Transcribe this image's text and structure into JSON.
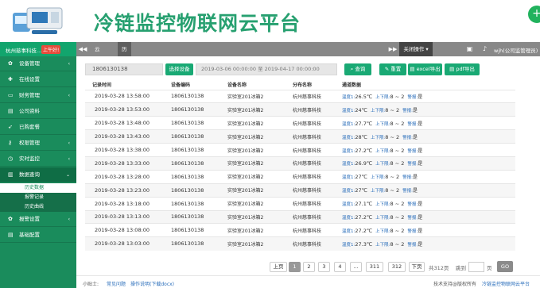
{
  "header": {
    "title": "冷链监控物联网云平台"
  },
  "topbar": {
    "user_name": "杭州慈事科技...",
    "shift": "上午好!",
    "nav_back": "◀◀",
    "nav_forward": "▶▶",
    "tabs": [
      "云中心",
      "历史数据"
    ],
    "close_ops": "关闭操作 ▾",
    "org": "wjh(公司监管理员)"
  },
  "sidebar": {
    "items": [
      {
        "label": "设备管理",
        "icon": "gear-icon",
        "arrow": "‹"
      },
      {
        "label": "在线设置",
        "icon": "signal-icon",
        "arrow": ""
      },
      {
        "label": "财务管理",
        "icon": "wallet-icon",
        "arrow": "‹"
      },
      {
        "label": "公司资料",
        "icon": "doc-icon",
        "arrow": ""
      },
      {
        "label": "已购套餐",
        "icon": "rocket-icon",
        "arrow": ""
      },
      {
        "label": "权限管理",
        "icon": "key-icon",
        "arrow": "‹"
      },
      {
        "label": "实时监控",
        "icon": "clock-icon",
        "arrow": "‹"
      },
      {
        "label": "数据查询",
        "icon": "chart-icon",
        "arrow": "⌄"
      }
    ],
    "sub_items": [
      "历史数据",
      "报警记录",
      "历史曲线"
    ],
    "after": [
      {
        "label": "报警设置",
        "icon": "bell-icon",
        "arrow": "‹"
      },
      {
        "label": "基础配置",
        "icon": "cog-icon",
        "arrow": ""
      }
    ]
  },
  "filters": {
    "device_code": "1806130138",
    "select_device": "选择设备",
    "date_range": "2019-03-06 00:00:00 至 2019-04-17 00:00:00",
    "query": "查询",
    "reset": "重置",
    "excel_export": "excel导出",
    "pdf_export": "pdf导出"
  },
  "table": {
    "columns": [
      "记录时间",
      "设备编码",
      "设备名称",
      "分布名称",
      "通道数据"
    ],
    "temp_label": "温度1:",
    "upper_label": "上下限:",
    "range": "8 ~ 2",
    "alarm_label": "警报:",
    "alarm_value": "是",
    "rows": [
      {
        "time": "2019-03-28 13:58:00",
        "code": "1806130138",
        "name": "实验室201冰箱2",
        "branch": "杭州慈事科技",
        "temp": "26.5℃"
      },
      {
        "time": "2019-03-28 13:53:00",
        "code": "1806130138",
        "name": "实验室201冰箱2",
        "branch": "杭州慈事科技",
        "temp": "24℃"
      },
      {
        "time": "2019-03-28 13:48:00",
        "code": "1806130138",
        "name": "实验室201冰箱2",
        "branch": "杭州慈事科技",
        "temp": "27.7℃"
      },
      {
        "time": "2019-03-28 13:43:00",
        "code": "1806130138",
        "name": "实验室201冰箱2",
        "branch": "杭州慈事科技",
        "temp": "28℃"
      },
      {
        "time": "2019-03-28 13:38:00",
        "code": "1806130138",
        "name": "实验室201冰箱2",
        "branch": "杭州慈事科技",
        "temp": "27.2℃"
      },
      {
        "time": "2019-03-28 13:33:00",
        "code": "1806130138",
        "name": "实验室201冰箱2",
        "branch": "杭州慈事科技",
        "temp": "26.9℃"
      },
      {
        "time": "2019-03-28 13:28:00",
        "code": "1806130138",
        "name": "实验室201冰箱2",
        "branch": "杭州慈事科技",
        "temp": "27℃"
      },
      {
        "time": "2019-03-28 13:23:00",
        "code": "1806130138",
        "name": "实验室201冰箱2",
        "branch": "杭州慈事科技",
        "temp": "27℃"
      },
      {
        "time": "2019-03-28 13:18:00",
        "code": "1806130138",
        "name": "实验室201冰箱2",
        "branch": "杭州慈事科技",
        "temp": "27.1℃"
      },
      {
        "time": "2019-03-28 13:13:00",
        "code": "1806130138",
        "name": "实验室201冰箱2",
        "branch": "杭州慈事科技",
        "temp": "27.2℃"
      },
      {
        "time": "2019-03-28 13:08:00",
        "code": "1806130138",
        "name": "实验室201冰箱2",
        "branch": "杭州慈事科技",
        "temp": "27.2℃"
      },
      {
        "time": "2019-03-28 13:03:00",
        "code": "1806130138",
        "name": "实验室201冰箱2",
        "branch": "杭州慈事科技",
        "temp": "27.3℃"
      }
    ]
  },
  "pagination": {
    "prev": "上页",
    "pages": [
      "1",
      "2",
      "3",
      "4",
      "...",
      "311",
      "312"
    ],
    "current": "1",
    "next": "下页",
    "total": "共312页",
    "goto_label": "跳到",
    "page_unit": "页",
    "go": "GO"
  },
  "footer": {
    "tip": "小贴士:",
    "faq": "常见问题",
    "manual": "操作说明(下载docx)",
    "support": "技术支持@版权所有",
    "platform": "冷链监控物联网云平台"
  },
  "colors": {
    "brand_green": "#1a8c5c",
    "accent_green": "#19a974",
    "link_blue": "#2a6ebb",
    "alert_red": "#e74c3c"
  }
}
